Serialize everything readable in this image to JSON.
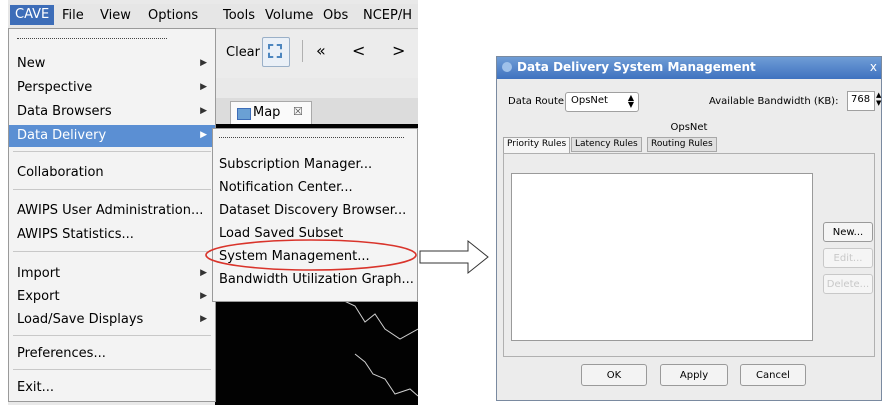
{
  "menubar": {
    "items": [
      "CAVE",
      "File",
      "View",
      "Options",
      "Tools",
      "Volume",
      "Obs",
      "NCEP/H"
    ]
  },
  "toolbar": {
    "clear_label": "Clear",
    "first_icon": "«",
    "prev_icon": "<",
    "next_icon": ">"
  },
  "map_tab": {
    "label": "Map",
    "close": "☒"
  },
  "cave_menu": {
    "items": [
      {
        "label": "New",
        "submenu": true
      },
      {
        "label": "Perspective",
        "submenu": true
      },
      {
        "label": "Data Browsers",
        "submenu": true
      },
      {
        "label": "Data Delivery",
        "submenu": true,
        "selected": true
      },
      {
        "label": "Collaboration",
        "submenu": false
      },
      {
        "label": "AWIPS User Administration...",
        "submenu": false
      },
      {
        "label": "AWIPS Statistics...",
        "submenu": false
      },
      {
        "label": "Import",
        "submenu": true
      },
      {
        "label": "Export",
        "submenu": true
      },
      {
        "label": "Load/Save Displays",
        "submenu": true
      },
      {
        "label": "Preferences...",
        "submenu": false
      },
      {
        "label": "Exit...",
        "submenu": false
      }
    ]
  },
  "data_delivery_menu": {
    "items": [
      "Subscription Manager...",
      "Notification Center...",
      "Dataset Discovery Browser...",
      "Load Saved Subset",
      "System Management...",
      "Bandwidth Utilization Graph..."
    ]
  },
  "dialog": {
    "title": "Data Delivery System Management",
    "close": "x",
    "route_label": "Data Route:",
    "route_value": "OpsNet",
    "bandwidth_label": "Available Bandwidth (KB):",
    "bandwidth_value": "768",
    "section_label": "OpsNet",
    "tabs": [
      "Priority Rules",
      "Latency Rules",
      "Routing Rules"
    ],
    "side_buttons": [
      "New...",
      "Edit...",
      "Delete..."
    ],
    "footer_buttons": [
      "OK",
      "Apply",
      "Cancel"
    ]
  },
  "colors": {
    "accent": "#3d6db8",
    "highlight_ring": "#d9342b"
  }
}
